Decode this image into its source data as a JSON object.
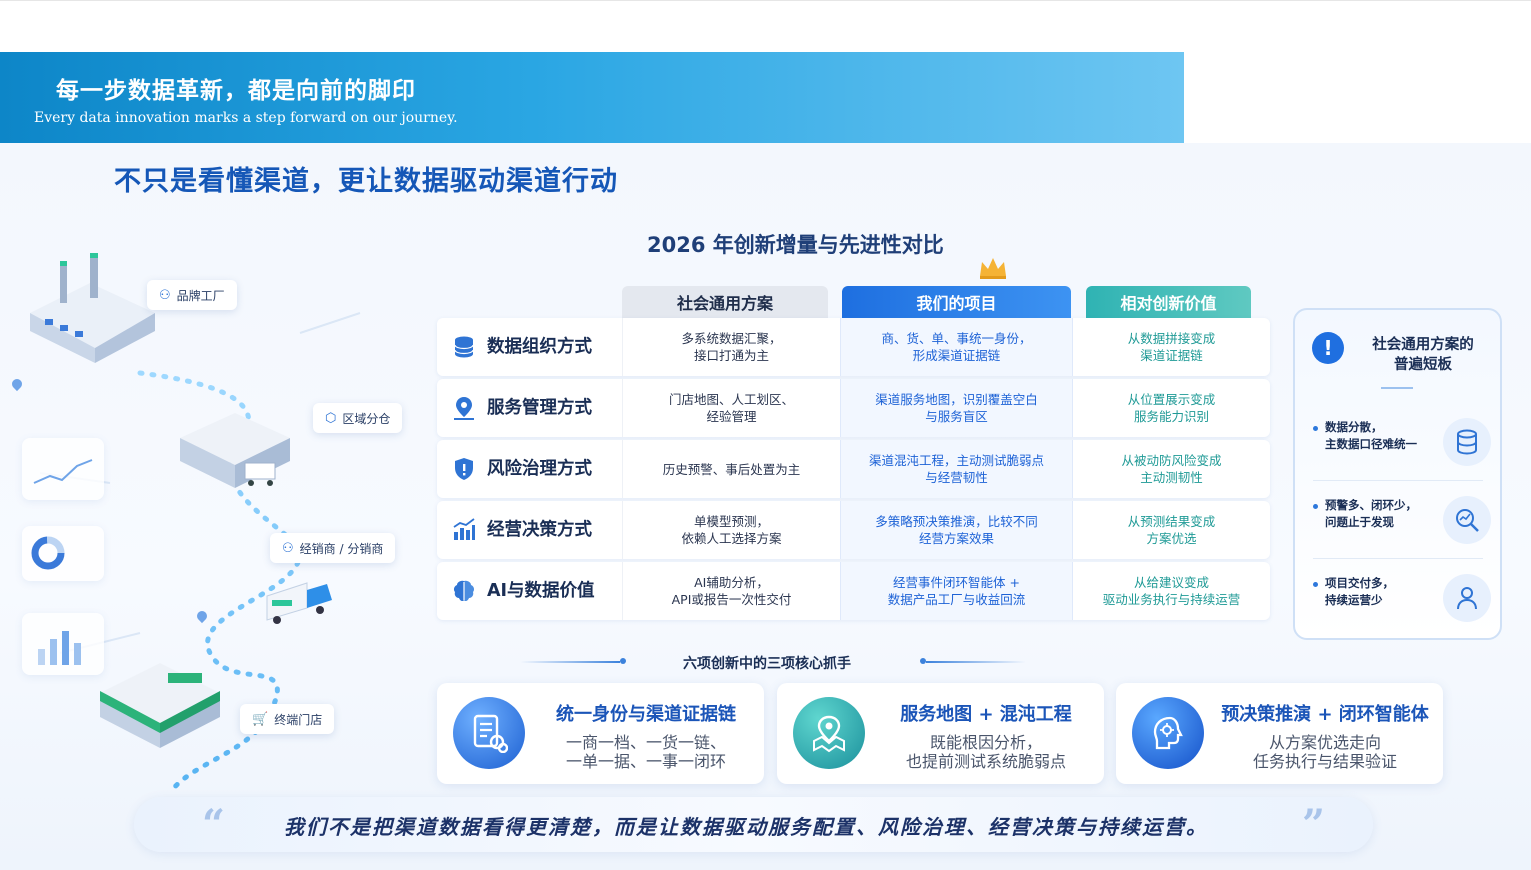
{
  "banner": {
    "title": "每一步数据革新，都是向前的脚印",
    "subtitle": "Every data innovation marks a step forward on our journey."
  },
  "headline": "不只是看懂渠道，更让数据驱动渠道行动",
  "illustration": {
    "tags": [
      {
        "label": "品牌工厂",
        "icon": "user-icon"
      },
      {
        "label": "区域分仓",
        "icon": "box-icon"
      },
      {
        "label": "经销商 / 分销商",
        "icon": "user-icon"
      },
      {
        "label": "终端门店",
        "icon": "cart-icon"
      }
    ]
  },
  "comparison": {
    "title": "2026 年创新增量与先进性对比",
    "headers": [
      "社会通用方案",
      "我们的项目",
      "相对创新价值"
    ],
    "rows": [
      {
        "label": "数据组织方式",
        "icon": "database-icon",
        "general": "多系统数据汇聚，\n接口打通为主",
        "ours": "商、货、单、事统一身份，\n形成渠道证据链",
        "value": "从数据拼接变成\n渠道证据链"
      },
      {
        "label": "服务管理方式",
        "icon": "map-pin-icon",
        "general": "门店地图、人工划区、\n经验管理",
        "ours": "渠道服务地图，识别覆盖空白\n与服务盲区",
        "value": "从位置展示变成\n服务能力识别"
      },
      {
        "label": "风险治理方式",
        "icon": "shield-icon",
        "general": "历史预警、事后处置为主",
        "ours": "渠道混沌工程，主动测试脆弱点\n与经营韧性",
        "value": "从被动防风险变成\n主动测韧性"
      },
      {
        "label": "经营决策方式",
        "icon": "bar-chart-icon",
        "general": "单模型预测，\n依赖人工选择方案",
        "ours": "多策略预决策推演，比较不同\n经营方案效果",
        "value": "从预测结果变成\n方案优选"
      },
      {
        "label": "AI与数据价值",
        "icon": "brain-icon",
        "general": "AI辅助分析，\nAPI或报告一次性交付",
        "ours": "经营事件闭环智能体 +\n数据产品工厂与收益回流",
        "value": "从给建议变成\n驱动业务执行与持续运营"
      }
    ]
  },
  "shortboard": {
    "title": "社会通用方案的\n普遍短板",
    "items": [
      {
        "text": "数据分散，\n主数据口径难统一",
        "icon": "database-icon"
      },
      {
        "text": "预警多、闭环少，\n问题止于发现",
        "icon": "search-chart-icon"
      },
      {
        "text": "项目交付多，\n持续运营少",
        "icon": "person-icon"
      }
    ]
  },
  "core": {
    "title": "六项创新中的三项核心抓手",
    "cards": [
      {
        "title": "统一身份与渠道证据链",
        "desc": "一商一档、一货一链、\n一单一据、一事一闭环",
        "icon": "document-link-icon"
      },
      {
        "title": "服务地图 + 混沌工程",
        "desc": "既能根因分析，\n也提前测试系统脆弱点",
        "icon": "map-location-icon"
      },
      {
        "title": "预决策推演 + 闭环智能体",
        "desc": "从方案优选走向\n任务执行与结果验证",
        "icon": "ai-head-icon"
      }
    ]
  },
  "quote": {
    "open": "“",
    "close": "”",
    "text": "我们不是把渠道数据看得更清楚，而是让数据驱动服务配置、风险治理、经营决策与持续运营。"
  },
  "colors": {
    "brand_blue": "#1557b7",
    "ours_blue": "#1d62d6",
    "value_teal": "#1f9a96",
    "banner_start": "#0d86c8"
  }
}
